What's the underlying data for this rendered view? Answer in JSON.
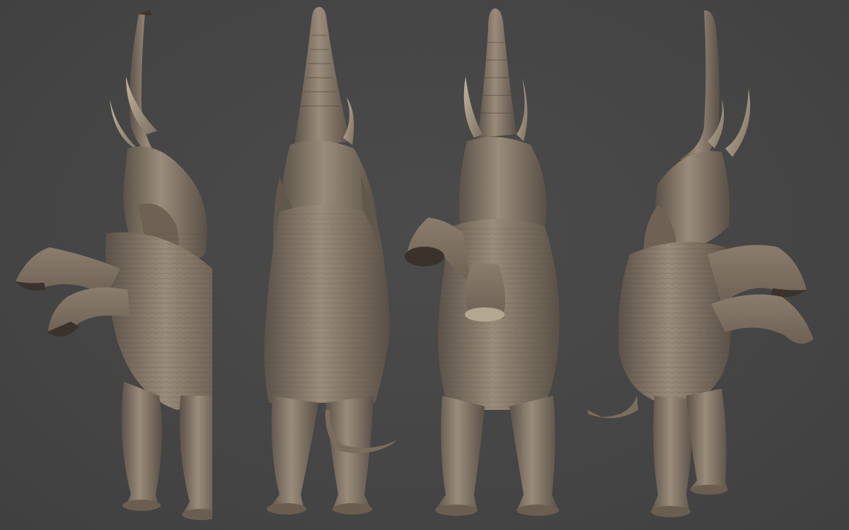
{
  "scene": {
    "background_color": "#464646",
    "subject": "elephant-3d-sculpt",
    "views": [
      {
        "name": "left-side"
      },
      {
        "name": "back"
      },
      {
        "name": "front"
      },
      {
        "name": "right-side"
      }
    ]
  },
  "palette": {
    "skin_light": "#9a8c7b",
    "skin_mid": "#7a6d5e",
    "skin_dark": "#4f463c",
    "tusk": "#a89a84",
    "shadow": "#2f2a25"
  }
}
